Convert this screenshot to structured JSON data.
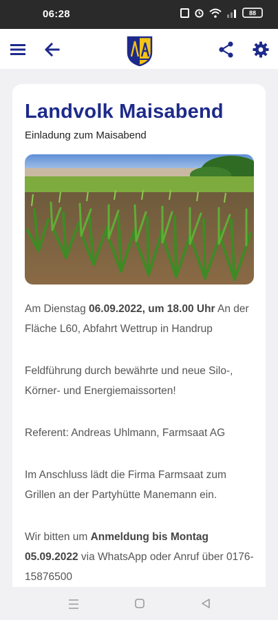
{
  "status_bar": {
    "time": "06:28",
    "battery": "88"
  },
  "app_bar": {
    "menu_icon": "menu-icon",
    "back_icon": "back-arrow-icon",
    "logo_icon": "coat-of-arms-logo",
    "share_icon": "share-icon",
    "settings_icon": "gear-icon",
    "accent_color": "#1d2a8a"
  },
  "article": {
    "title": "Landvolk Maisabend",
    "subtitle": "Einladung zum Maisabend",
    "p1_a": "Am Dienstag ",
    "p1_b": "06.09.2022, um 18.00 Uhr",
    "p1_c": " An der Fläche L60, Abfahrt Wettrup in Handrup",
    "p2": "Feldführung durch bewährte und neue Silo-, Körner- und Energiemaissorten!",
    "p3": "Referent: Andreas Uhlmann, Farmsaat AG",
    "p4": "Im Anschluss lädt die Firma Farmsaat zum Grillen an der Partyhütte Manemann ein.",
    "p5_a": "Wir bitten um ",
    "p5_b": "Anmeldung bis Montag 05.09.2022",
    "p5_c": " via WhatsApp oder Anruf über 0176-15876500"
  },
  "nav_bar": {
    "recents_icon": "recents-icon",
    "home_icon": "home-icon",
    "back_icon": "system-back-icon"
  }
}
